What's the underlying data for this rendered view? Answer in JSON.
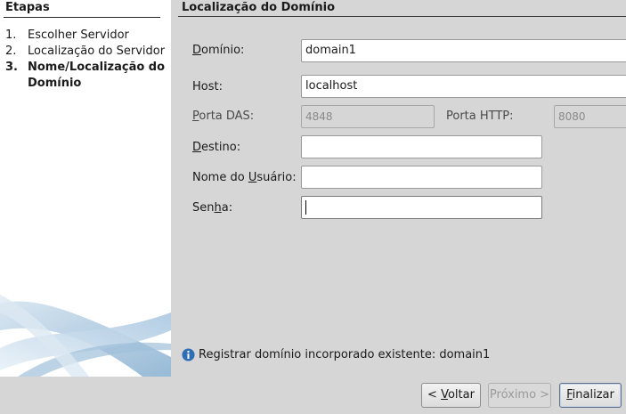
{
  "steps": {
    "title": "Etapas",
    "items": [
      {
        "num": "1.",
        "label": "Escolher Servidor"
      },
      {
        "num": "2.",
        "label": "Localização do Servidor"
      },
      {
        "num": "3.",
        "label_line1": "Nome/Localização do",
        "label_line2": "Domínio"
      }
    ]
  },
  "content": {
    "title": "Localização do Domínio",
    "fields": {
      "domain": {
        "label_pre": "",
        "label_mnemonic": "D",
        "label_post": "omínio:",
        "value": "domain1"
      },
      "host": {
        "label": "Host:",
        "value": "localhost"
      },
      "das_port": {
        "label_pre": "",
        "label_mnemonic": "P",
        "label_post": "orta DAS:",
        "value": "4848"
      },
      "http_port": {
        "label": "Porta HTTP:",
        "value": "8080"
      },
      "destination": {
        "label_pre": "",
        "label_mnemonic": "D",
        "label_post": "estino:",
        "value": ""
      },
      "username": {
        "label_pre": "Nome do ",
        "label_mnemonic": "U",
        "label_post": "suário:",
        "value": ""
      },
      "password": {
        "label_pre": "Sen",
        "label_mnemonic": "h",
        "label_post": "a:",
        "value": ""
      }
    },
    "info": {
      "icon": "info-icon",
      "text": "Registrar domínio incorporado existente: domain1"
    }
  },
  "buttons": {
    "back": {
      "pre": "< ",
      "mnemonic": "V",
      "post": "oltar"
    },
    "next": {
      "label": "Próximo >"
    },
    "finish": {
      "pre": "",
      "mnemonic": "F",
      "post": "inalizar"
    }
  },
  "colors": {
    "panel_bg": "#d6d6d6",
    "steps_bg": "#ffffff",
    "info_icon": "#2f6db5"
  }
}
